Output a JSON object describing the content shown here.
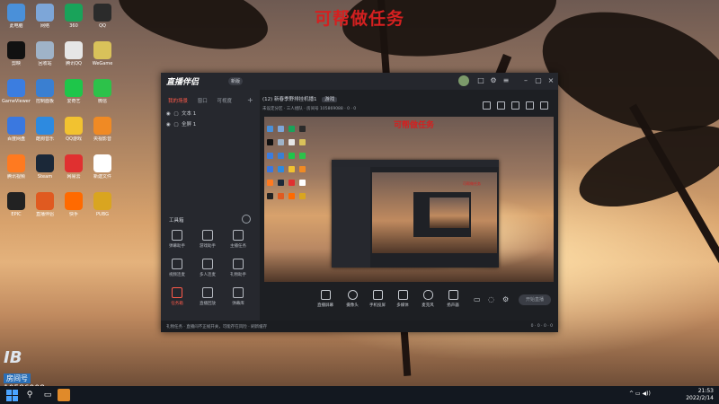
{
  "overlay_title": "可帮做任务",
  "watermark": {
    "logo": "IB",
    "room_label": "房间号",
    "room_number": "10586908"
  },
  "desktop_icons": [
    {
      "label": "此电脑",
      "color": "#4a90d9"
    },
    {
      "label": "网络",
      "color": "#7da6d8"
    },
    {
      "label": "360",
      "color": "#19a35a"
    },
    {
      "label": "QQ",
      "color": "#2b2b2b"
    },
    {
      "label": "剪映",
      "color": "#111111"
    },
    {
      "label": "回收站",
      "color": "#9fb3c8"
    },
    {
      "label": "腾讯QQ",
      "color": "#e6e6e6"
    },
    {
      "label": "WeGame",
      "color": "#d9c25a"
    },
    {
      "label": "GameViewer",
      "color": "#3b7de0"
    },
    {
      "label": "控制面板",
      "color": "#3a7fd1"
    },
    {
      "label": "爱奇艺",
      "color": "#1ec64a"
    },
    {
      "label": "微信",
      "color": "#2dc24a"
    },
    {
      "label": "百度网盘",
      "color": "#3a78e0"
    },
    {
      "label": "酷狗音乐",
      "color": "#2d8ae0"
    },
    {
      "label": "QQ游戏",
      "color": "#f2c230"
    },
    {
      "label": "央视影音",
      "color": "#f08a24"
    },
    {
      "label": "腾讯视频",
      "color": "#ff7a20"
    },
    {
      "label": "Steam",
      "color": "#1b2838"
    },
    {
      "label": "网易云",
      "color": "#e03030"
    },
    {
      "label": "新建文件",
      "color": "#ffffff"
    },
    {
      "label": "EPIC",
      "color": "#222222"
    },
    {
      "label": "直播伴侣",
      "color": "#e05a20"
    },
    {
      "label": "快手",
      "color": "#ff6a00"
    },
    {
      "label": "PUBG",
      "color": "#d9a520"
    }
  ],
  "taskbar": {
    "time": "21:53",
    "date": "2022/2/14"
  },
  "window": {
    "app_name": "直播伴侣",
    "version": "新版",
    "sidebar_tabs": [
      "我的场景",
      "窗口",
      "可视度"
    ],
    "scenes": [
      "文本 1",
      "全屏 1"
    ],
    "tools_title": "工具箱",
    "tools": [
      {
        "label": "弹幕助手"
      },
      {
        "label": "游戏助手"
      },
      {
        "label": "主播任务"
      },
      {
        "label": "视频连麦"
      },
      {
        "label": "多人连麦"
      },
      {
        "label": "礼物助手"
      },
      {
        "label": "任务箱"
      },
      {
        "label": "直播回放"
      },
      {
        "label": "弹幕库"
      }
    ],
    "room_title": "(12) 新春季野排挂机播1",
    "room_tag": "游戏",
    "room_meta": "未设定分区 · 三人组队 · 房间号 105869088 · 0 · 0",
    "preview_title": "可帮做任务",
    "bottom_tools": [
      {
        "label": "直播屏幕"
      },
      {
        "label": "摄像头"
      },
      {
        "label": "手机投屏"
      },
      {
        "label": "多媒体"
      },
      {
        "label": "麦克风"
      },
      {
        "label": "扬声器"
      }
    ],
    "live_button": "开始直播",
    "status_bar": "礼物任务 · 直播间不正规开关，可能存在风险 · 刷新缓存",
    "status_right": "0 · 0 · 0 · 0"
  }
}
